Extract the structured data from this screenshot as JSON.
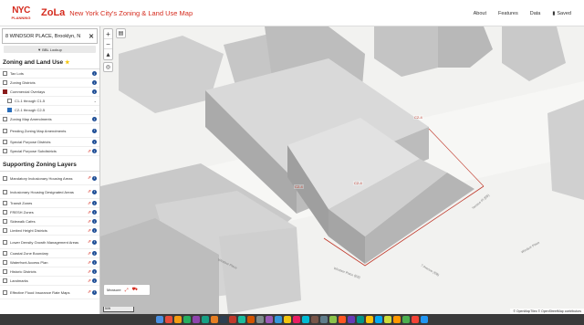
{
  "header": {
    "logo_top": "NYC",
    "logo_bottom": "PLANNING",
    "app_name": "ZoLa",
    "subtitle": "New York City's Zoning & Land Use Map",
    "nav": [
      "About",
      "Features",
      "Data"
    ],
    "saved_label": "Saved"
  },
  "search": {
    "value": "8 WINDSOR PLACE, Brooklyn, N",
    "bbl_label": "▼ BBL Lookup"
  },
  "sections": [
    {
      "title": "Zoning and Land Use",
      "layers": [
        {
          "label": "Tax Lots",
          "checked": false
        },
        {
          "label": "Zoning Districts",
          "checked": false
        },
        {
          "label": "Commercial Overlays",
          "checked": true
        },
        {
          "label": "C1-1 through C1-5",
          "checked": false,
          "sub": true
        },
        {
          "label": "C2-1 through C2-5",
          "checked": true,
          "sub": true
        },
        {
          "label": "Zoning Map Amendments",
          "checked": false
        },
        {
          "label": "Pending Zoning Map Amendments",
          "checked": false
        },
        {
          "label": "Special Purpose Districts",
          "checked": false
        },
        {
          "label": "Special Purpose Subdistricts",
          "checked": false
        }
      ]
    },
    {
      "title": "Supporting Zoning Layers",
      "layers": [
        {
          "label": "Mandatory Inclusionary Housing Areas",
          "checked": false
        },
        {
          "label": "Inclusionary Housing Designated Areas",
          "checked": false
        },
        {
          "label": "Transit Zones",
          "checked": false
        },
        {
          "label": "FRESH Zones",
          "checked": false
        },
        {
          "label": "Sidewalk Cafes",
          "checked": false
        },
        {
          "label": "Limited Height Districts",
          "checked": false
        },
        {
          "label": "Lower Density Growth Management Areas",
          "checked": false
        },
        {
          "label": "Coastal Zone Boundary",
          "checked": false
        },
        {
          "label": "Waterfront Access Plan",
          "checked": false
        },
        {
          "label": "Historic Districts",
          "checked": false
        },
        {
          "label": "Landmarks",
          "checked": false
        },
        {
          "label": "Effective Flood Insurance Rate Maps",
          "checked": false
        }
      ]
    }
  ],
  "map": {
    "zone_labels": [
      "C2-4",
      "C2-4",
      "C2-4"
    ],
    "streets": [
      "Windsor Place (EB)",
      "7 Avenue (EB)",
      "Terrace Pl (EB)",
      "Windsor Place",
      "Windsor Place"
    ],
    "measure_label": "Measure",
    "scale_label": "50ft",
    "attribution": "© OpenMapTiles © OpenStreetMap contributors"
  },
  "colors": {
    "brand_red": "#d52b1e",
    "info_blue": "#1f4e96",
    "commercial_overlay": "#8a1c1c"
  }
}
